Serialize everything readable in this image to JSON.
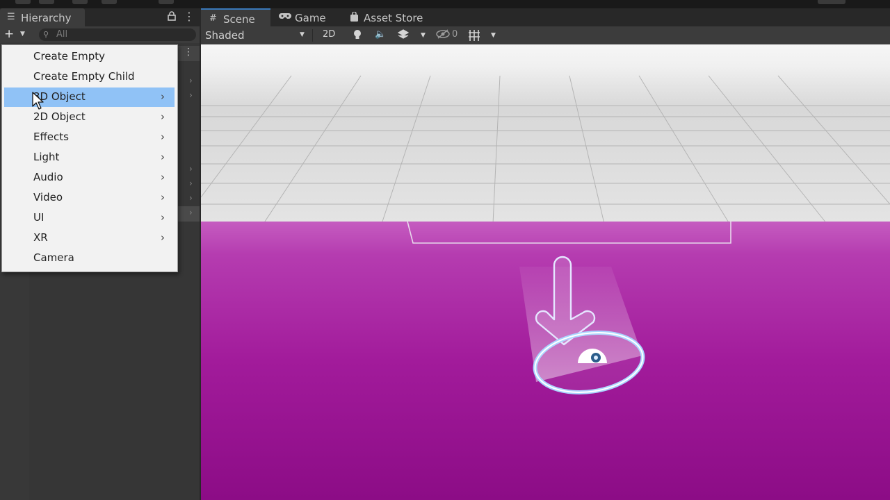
{
  "hierarchy": {
    "title": "Hierarchy",
    "search_placeholder": "All"
  },
  "context_menu": {
    "items": [
      {
        "label": "Create Empty",
        "submenu": false
      },
      {
        "label": "Create Empty Child",
        "submenu": false
      },
      {
        "label": "3D Object",
        "submenu": true,
        "highlighted": true
      },
      {
        "label": "2D Object",
        "submenu": true
      },
      {
        "label": "Effects",
        "submenu": true
      },
      {
        "label": "Light",
        "submenu": true
      },
      {
        "label": "Audio",
        "submenu": true
      },
      {
        "label": "Video",
        "submenu": true
      },
      {
        "label": "UI",
        "submenu": true
      },
      {
        "label": "XR",
        "submenu": true
      },
      {
        "label": "Camera",
        "submenu": false
      }
    ],
    "submenu_glyph": "›",
    "highlight_color": "#90c2f6"
  },
  "scene_tabs": {
    "scene": "Scene",
    "game": "Game",
    "asset_store": "Asset Store"
  },
  "scene_toolbar": {
    "shading_mode": "Shaded",
    "mode_2d": "2D",
    "hidden_count": "0"
  },
  "colors": {
    "editor_dark": "#282828",
    "panel": "#383838",
    "skybox_top": "#c2c2c2",
    "ground_magenta": "#a5169e",
    "selection_blue": "#3a79bb"
  },
  "icons": [
    "hamburger-icon",
    "lock-icon",
    "kebab-icon",
    "plus-icon",
    "search-icon",
    "scene-hash-icon",
    "gamepad-icon",
    "bag-icon",
    "light-bulb-icon",
    "audio-icon",
    "fx-icon",
    "eye-hidden-icon",
    "grid-icon",
    "cursor-arrow-icon",
    "directional-light-icon",
    "camera-icon"
  ]
}
